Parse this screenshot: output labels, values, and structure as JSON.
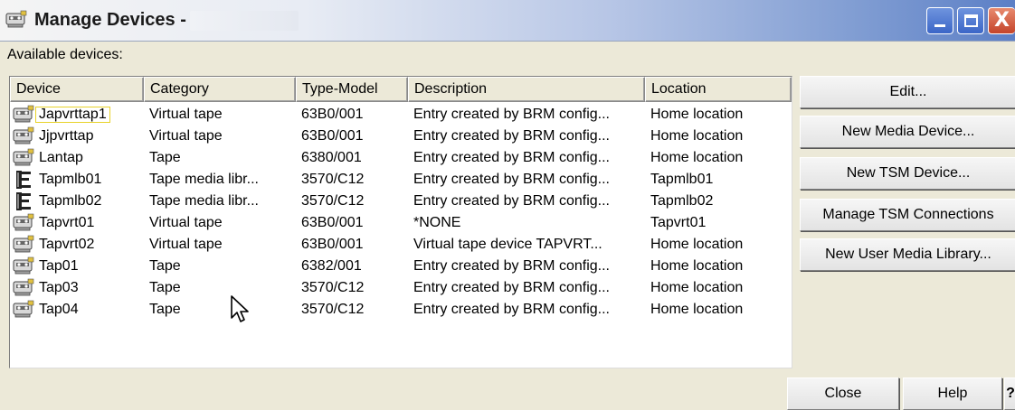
{
  "window": {
    "title": "Manage Devices -",
    "minimize_icon": "minimize-icon",
    "maximize_icon": "maximize-icon",
    "close_glyph": "X"
  },
  "available_label": "Available devices:",
  "table": {
    "columns": [
      "Device",
      "Category",
      "Type-Model",
      "Description",
      "Location"
    ],
    "rows": [
      {
        "icon": "tape-device-icon",
        "device": "Japvrttap1",
        "category": "Virtual tape",
        "type_model": "63B0/001",
        "description": "Entry created by BRM config...",
        "location": "Home location"
      },
      {
        "icon": "tape-device-icon",
        "device": "Jjpvrttap",
        "category": "Virtual tape",
        "type_model": "63B0/001",
        "description": "Entry created by BRM config...",
        "location": "Home location"
      },
      {
        "icon": "tape-device-icon",
        "device": "Lantap",
        "category": "Tape",
        "type_model": "6380/001",
        "description": "Entry created by BRM config...",
        "location": "Home location"
      },
      {
        "icon": "media-library-icon",
        "device": "Tapmlb01",
        "category": "Tape media libr...",
        "type_model": "3570/C12",
        "description": "Entry created by BRM config...",
        "location": "Tapmlb01"
      },
      {
        "icon": "media-library-icon",
        "device": "Tapmlb02",
        "category": "Tape media libr...",
        "type_model": "3570/C12",
        "description": "Entry created by BRM config...",
        "location": "Tapmlb02"
      },
      {
        "icon": "tape-device-icon",
        "device": "Tapvrt01",
        "category": "Virtual tape",
        "type_model": "63B0/001",
        "description": "*NONE",
        "location": "Tapvrt01"
      },
      {
        "icon": "tape-device-icon",
        "device": "Tapvrt02",
        "category": "Virtual tape",
        "type_model": "63B0/001",
        "description": "Virtual tape device TAPVRT...",
        "location": "Home location"
      },
      {
        "icon": "tape-device-icon",
        "device": "Tap01",
        "category": "Tape",
        "type_model": "6382/001",
        "description": "Entry created by BRM config...",
        "location": "Home location"
      },
      {
        "icon": "tape-device-icon",
        "device": "Tap03",
        "category": "Tape",
        "type_model": "3570/C12",
        "description": "Entry created by BRM config...",
        "location": "Home location"
      },
      {
        "icon": "tape-device-icon",
        "device": "Tap04",
        "category": "Tape",
        "type_model": "3570/C12",
        "description": "Entry created by BRM config...",
        "location": "Home location"
      }
    ]
  },
  "actions": {
    "edit": "Edit...",
    "new_media_device": "New Media Device...",
    "new_tsm_device": "New TSM Device...",
    "manage_tsm_connections": "Manage TSM Connections",
    "new_user_media_library": "New User Media Library..."
  },
  "footer": {
    "close": "Close",
    "help": "Help",
    "whats_this": "?"
  }
}
